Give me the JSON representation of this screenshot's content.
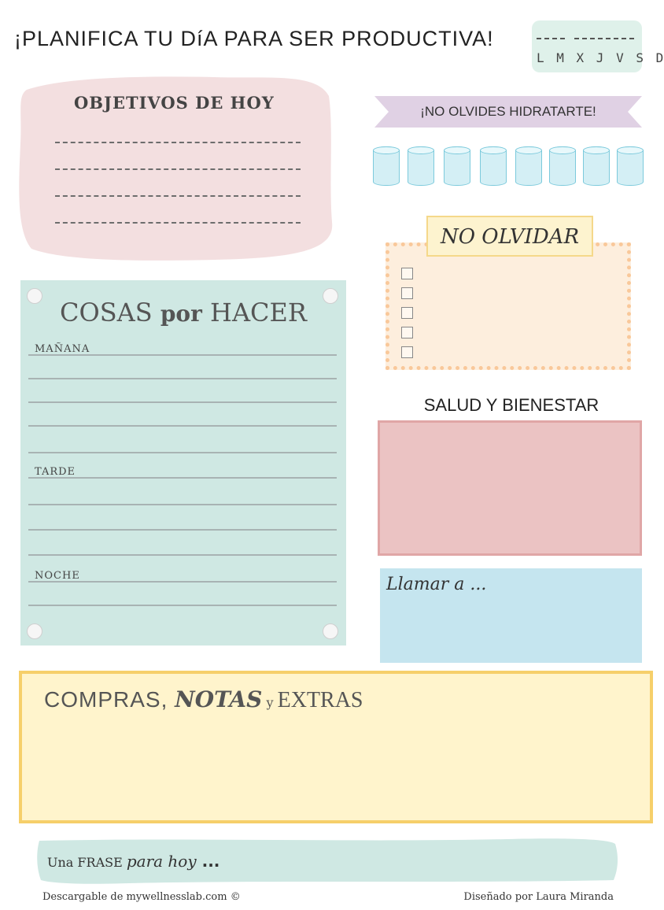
{
  "header": {
    "title": "¡PLANIFICA TU DíA PARA SER PRODUCTIVA!",
    "days": "L M X J V S D"
  },
  "objetivos": {
    "title": "OBJETIVOS DE HOY",
    "line_count": 4
  },
  "hydrate": {
    "title": "¡NO OLVIDES HIDRATARTE!",
    "glass_count": 8
  },
  "no_olvidar": {
    "title": "NO OLVIDAR",
    "checkbox_count": 5
  },
  "cosas": {
    "title_part1": "COSAS ",
    "title_part2": "por",
    "title_part3": " HACER",
    "sections": [
      "MAÑANA",
      "TARDE",
      "NOCHE"
    ]
  },
  "salud": {
    "title": "SALUD Y BIENESTAR"
  },
  "llamar": {
    "title": "Llamar a ..."
  },
  "compras": {
    "part1": "COMPRAS, ",
    "part2": "NOTAS",
    "part3": " y ",
    "part4": "EXTRAS"
  },
  "frase": {
    "part1": "Una FRASE ",
    "part2": "para hoy",
    "part3": " ..."
  },
  "footer": {
    "left": "Descargable de mywellnesslab.com ©",
    "right": "Diseñado por Laura Miranda"
  },
  "colors": {
    "pink": "#f3dfe0",
    "mint": "#cfe8e3",
    "lavender": "#e0d1e4",
    "peach": "#fdeedd",
    "rose": "#ebc3c3",
    "sky": "#c5e5ef",
    "butter": "#fff4cc"
  }
}
